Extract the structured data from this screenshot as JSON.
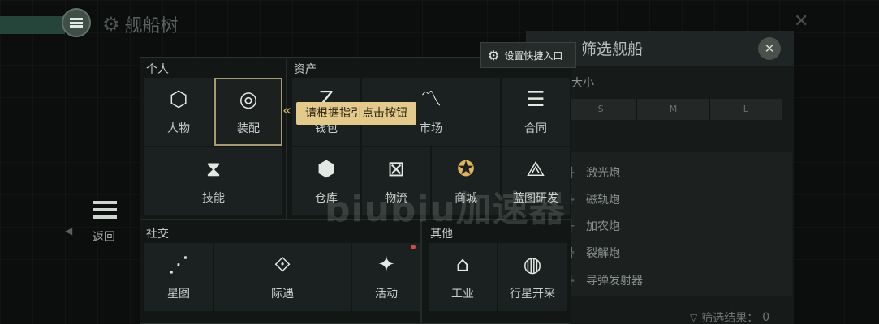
{
  "header": {
    "title": "舰船树"
  },
  "filter": {
    "title": "筛选舰船",
    "size_label": "大小",
    "sizes": [
      "S",
      "M",
      "L"
    ],
    "weapons": [
      "激光炮",
      "磁轨炮",
      "加农炮",
      "裂解炮",
      "导弹发射器"
    ],
    "result_label": "筛选结果：",
    "result_count": "0"
  },
  "back": {
    "label": "返回"
  },
  "shortcut": {
    "label": "设置快捷入口"
  },
  "tooltip": {
    "text": "请根据指引点击按钮"
  },
  "sections": {
    "personal": {
      "label": "个人",
      "items": [
        {
          "label": "人物",
          "icon": "person-icon"
        },
        {
          "label": "装配",
          "icon": "fitting-icon"
        },
        {
          "label": "技能",
          "icon": "skill-icon"
        }
      ]
    },
    "assets": {
      "label": "资产",
      "items": [
        {
          "label": "钱包",
          "icon": "wallet-icon"
        },
        {
          "label": "市场",
          "icon": "market-icon"
        },
        {
          "label": "合同",
          "icon": "contract-icon"
        },
        {
          "label": "仓库",
          "icon": "warehouse-icon"
        },
        {
          "label": "物流",
          "icon": "logistics-icon"
        },
        {
          "label": "商城",
          "icon": "store-icon"
        },
        {
          "label": "蓝图研发",
          "icon": "blueprint-icon"
        }
      ]
    },
    "social": {
      "label": "社交",
      "items": [
        {
          "label": "星图",
          "icon": "starmap-icon"
        },
        {
          "label": "际遇",
          "icon": "encounter-icon"
        },
        {
          "label": "活动",
          "icon": "event-icon"
        }
      ]
    },
    "other": {
      "label": "其他",
      "items": [
        {
          "label": "工业",
          "icon": "industry-icon"
        },
        {
          "label": "行星开采",
          "icon": "planet-icon"
        }
      ]
    }
  },
  "watermark": "biubiu加速器",
  "colors": {
    "accent": "#e3c98a",
    "panel": "#121615",
    "tile": "#1b2120",
    "badge": "#d24b43"
  }
}
